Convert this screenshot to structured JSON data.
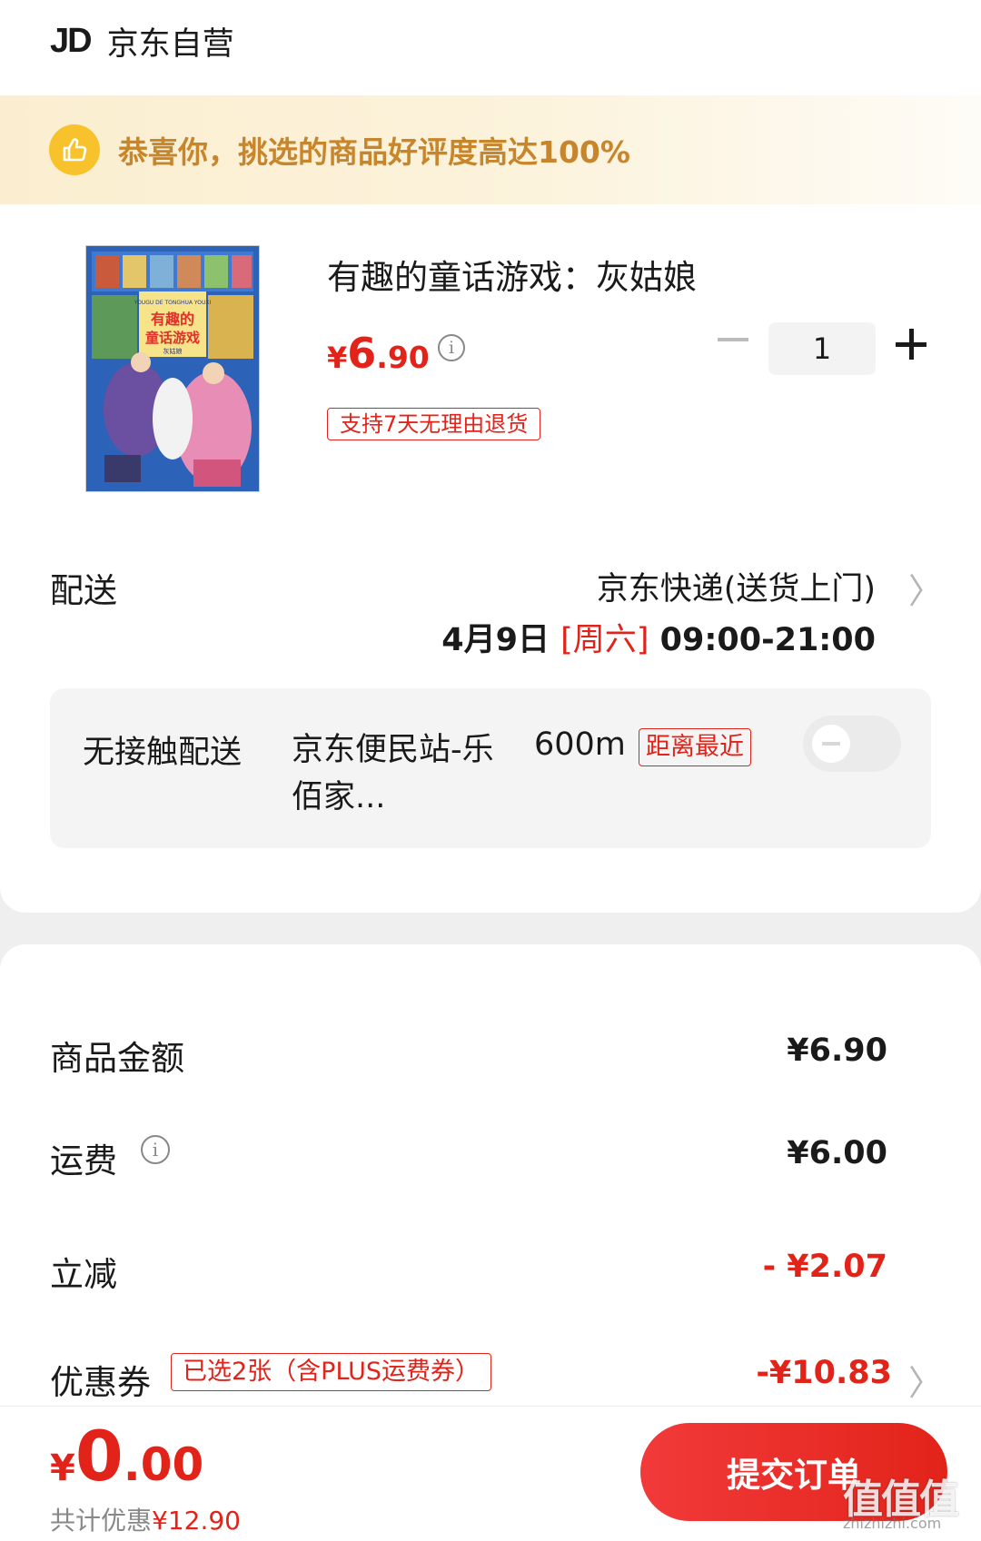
{
  "store": {
    "logo": "JD",
    "name": "京东自营"
  },
  "rating_banner": {
    "text": "恭喜你，挑选的商品好评度高达100%",
    "icon": "thumbs-up-icon"
  },
  "product": {
    "title": "有趣的童话游戏：灰姑娘",
    "price_symbol": "¥",
    "price_int": "6",
    "price_dec": ".90",
    "quantity": "1",
    "return_policy": "支持7天无理由退货",
    "cover": {
      "top_text": "YOUGU DE TONGHUA YOUXI",
      "title_line1": "有趣的",
      "title_line2": "童话游戏",
      "subtitle": "灰姑娘",
      "colors": {
        "background": "#2c62b8",
        "title": "#e0302a"
      }
    }
  },
  "delivery": {
    "label": "配送",
    "method": "京东快递(送货上门)",
    "date": "4月9日",
    "weekday": "[周六]",
    "time": "09:00-21:00"
  },
  "contactless": {
    "label": "无接触配送",
    "station": "京东便民站-乐佰家...",
    "distance": "600m",
    "badge": "距离最近",
    "enabled": false
  },
  "summary": {
    "goods_label": "商品金额",
    "goods_value": "¥6.90",
    "shipping_label": "运费",
    "shipping_value": "¥6.00",
    "instant_discount_label": "立减",
    "instant_discount_value": "- ¥2.07",
    "coupon_label": "优惠券",
    "coupon_badge": "已选2张（含PLUS运费券）",
    "coupon_value": "-¥10.83"
  },
  "footer": {
    "total_symbol": "¥",
    "total_int": "0",
    "total_dec": ".00",
    "discount_label": "共计优惠",
    "discount_amount": "¥12.90",
    "submit_label": "提交订单"
  },
  "watermark": {
    "text": "值值值",
    "url": "zhizhizhi.com"
  },
  "colors": {
    "accent": "#e2231a",
    "banner_text": "#c8862c",
    "thumb": "#f7c22b"
  }
}
